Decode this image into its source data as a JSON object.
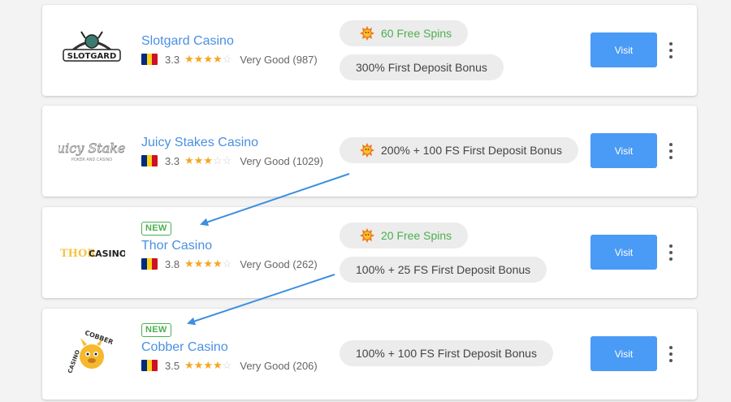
{
  "colors": {
    "accent": "#4a9bf5",
    "link": "#4a90e2",
    "new_badge": "#4caf50",
    "star": "#f5a623",
    "flag": [
      "#002b7f",
      "#fcd116",
      "#ce1126"
    ]
  },
  "casinos": [
    {
      "logo_text": "SLOTGARD",
      "name": "Slotgard Casino",
      "new": false,
      "rating": "3.3",
      "stars": "3.3",
      "rating_label": "Very Good (987)",
      "spins": "60 Free Spins",
      "bonus": "300% First Deposit Bonus",
      "visit_label": "Visit"
    },
    {
      "logo_text": "Juicy Stakes",
      "logo_subtext": "POKER AND CASINO",
      "name": "Juicy Stakes Casino",
      "new": false,
      "rating": "3.3",
      "stars": "3.3",
      "rating_label": "Very Good (1029)",
      "spins": "200% + 100 FS First Deposit Bonus",
      "visit_label": "Visit"
    },
    {
      "logo_text_a": "THOR",
      "logo_text_b": "CASINO",
      "name": "Thor Casino",
      "new": true,
      "new_label": "NEW",
      "rating": "3.8",
      "stars": "3.8",
      "rating_label": "Very Good (262)",
      "spins": "20 Free Spins",
      "bonus": "100% + 25 FS First Deposit Bonus",
      "visit_label": "Visit"
    },
    {
      "logo_text_a": "COBBER",
      "logo_text_b": "CASINO",
      "name": "Cobber Casino",
      "new": true,
      "new_label": "NEW",
      "rating": "3.5",
      "stars": "3.5",
      "rating_label": "Very Good (206)",
      "bonus": "100% + 100 FS First Deposit Bonus",
      "visit_label": "Visit"
    }
  ]
}
